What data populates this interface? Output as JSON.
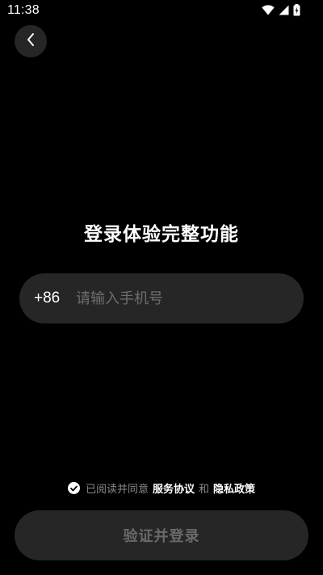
{
  "status_bar": {
    "time": "11:38",
    "icons": [
      "wifi-icon",
      "signal-icon",
      "battery-charging-icon"
    ]
  },
  "header": {
    "back_icon": "chevron-left-icon"
  },
  "main": {
    "title": "登录体验完整功能",
    "phone": {
      "country_code": "+86",
      "placeholder": "请输入手机号",
      "value": ""
    },
    "agreement": {
      "checked": true,
      "prefix": "已阅读并同意",
      "terms_link": "服务协议",
      "conjunction": "和",
      "privacy_link": "隐私政策"
    },
    "submit_label": "验证并登录"
  },
  "colors": {
    "background": "#000000",
    "surface": "#262626",
    "text_primary": "#ffffff",
    "text_muted": "#8a8a8a",
    "placeholder": "#6e6e6e",
    "button_disabled_text": "#6a6a6a"
  }
}
